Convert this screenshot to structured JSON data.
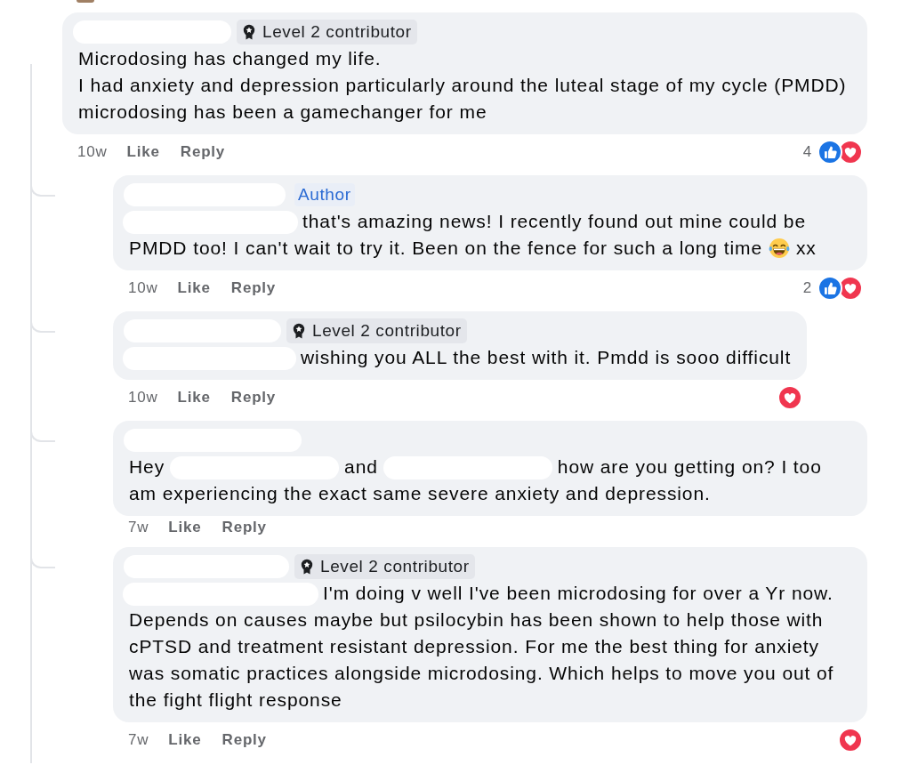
{
  "thread": {
    "author": {
      "kind": "redacted"
    },
    "badge": {
      "kind": "contributor",
      "label": "Level 2 contributor"
    },
    "body": [
      {
        "kind": "text",
        "text": "Microdosing has changed my life.\nI had anxiety and depression particularly around the luteal stage of my cycle (PMDD) microdosing has been a gamechanger for me"
      }
    ],
    "time": "10w",
    "actions": [
      "Like",
      "Reply"
    ],
    "reaction_count": "4",
    "reactions": [
      {
        "kind": "like"
      },
      {
        "kind": "love"
      }
    ],
    "children": [
      {
        "author": {
          "kind": "redacted"
        },
        "badge": {
          "kind": "author",
          "label": "Author"
        },
        "body": [
          {
            "kind": "redacted"
          },
          {
            "kind": "text",
            "text": "that's amazing news! I recently found out mine could be PMDD too! I can't wait to try it. Been on the fence for such a long time"
          },
          {
            "kind": "emoji"
          },
          {
            "kind": "text",
            "text": "xx"
          }
        ],
        "time": "10w",
        "actions": [
          "Like",
          "Reply"
        ],
        "reaction_count": "2",
        "reactions": [
          {
            "kind": "like"
          },
          {
            "kind": "love"
          }
        ]
      },
      {
        "author": {
          "kind": "redacted"
        },
        "badge": {
          "kind": "contributor",
          "label": "Level 2 contributor"
        },
        "body": [
          {
            "kind": "redacted"
          },
          {
            "kind": "text",
            "text": "wishing you ALL the best with it. Pmdd is sooo difficult"
          }
        ],
        "time": "10w",
        "actions": [
          "Like",
          "Reply"
        ],
        "reactions": [
          {
            "kind": "love"
          }
        ]
      },
      {
        "author": {
          "kind": "redacted"
        },
        "body": [
          {
            "kind": "text",
            "text": "Hey"
          },
          {
            "kind": "redacted"
          },
          {
            "kind": "text",
            "text": "and"
          },
          {
            "kind": "redacted"
          },
          {
            "kind": "text",
            "text": "how are you getting on? I too am experiencing the exact same severe anxiety and depression."
          }
        ],
        "time": "7w",
        "actions": [
          "Like",
          "Reply"
        ]
      },
      {
        "author": {
          "kind": "redacted"
        },
        "badge": {
          "kind": "contributor",
          "label": "Level 2 contributor"
        },
        "body": [
          {
            "kind": "redacted"
          },
          {
            "kind": "text",
            "text": "I'm doing v well I've been microdosing for over a Yr now. Depends on causes maybe but psilocybin has been shown to help those with cPTSD and treatment resistant depression. For me the best thing for anxiety was somatic practices alongside microdosing. Which helps to move you out of the fight flight response"
          }
        ],
        "time": "7w",
        "actions": [
          "Like",
          "Reply"
        ],
        "reactions": [
          {
            "kind": "love"
          }
        ]
      }
    ]
  }
}
